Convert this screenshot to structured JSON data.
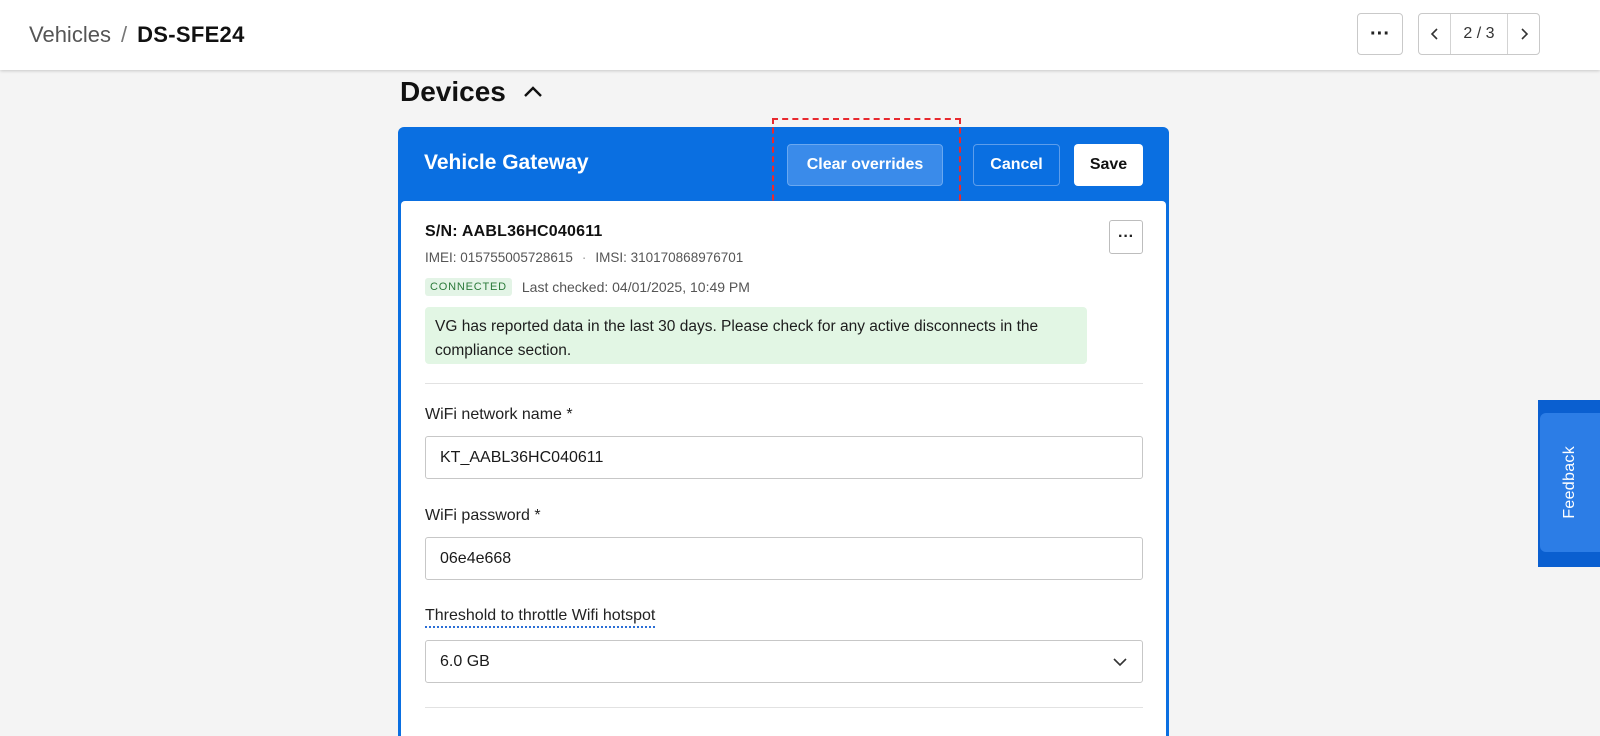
{
  "header": {
    "breadcrumb_parent": "Vehicles",
    "breadcrumb_sep": "/",
    "breadcrumb_current": "DS-SFE24",
    "more_label": "···",
    "pager": {
      "text": "2 / 3"
    }
  },
  "section": {
    "title": "Devices"
  },
  "card": {
    "title": "Vehicle Gateway",
    "clear_overrides_label": "Clear overrides",
    "cancel_label": "Cancel",
    "save_label": "Save",
    "more_label": "···",
    "serial": "S/N: AABL36HC040611",
    "imei": "IMEI: 015755005728615",
    "imsi": "IMSI: 310170868976701",
    "id_separator": "·",
    "status_badge": "CONNECTED",
    "last_checked": "Last checked: 04/01/2025, 10:49 PM",
    "notice": "VG has reported data in the last 30 days. Please check for any active disconnects in the compliance section."
  },
  "form": {
    "wifi_name": {
      "label": "WiFi network name *",
      "value": "KT_AABL36HC040611"
    },
    "wifi_password": {
      "label": "WiFi password *",
      "value": "06e4e668"
    },
    "threshold": {
      "label": "Threshold to throttle Wifi hotspot",
      "selected": "6.0 GB"
    }
  },
  "feedback": {
    "label": "Feedback"
  },
  "colors": {
    "brand_blue": "#0a6fe1",
    "highlight": "#e8292e",
    "success_bg": "#e2f6e4",
    "success_text": "#2b7a3a"
  },
  "icons": [
    "chevron-left-icon",
    "chevron-right-icon",
    "chevron-up-icon",
    "chevron-down-icon",
    "more-horizontal-icon"
  ]
}
